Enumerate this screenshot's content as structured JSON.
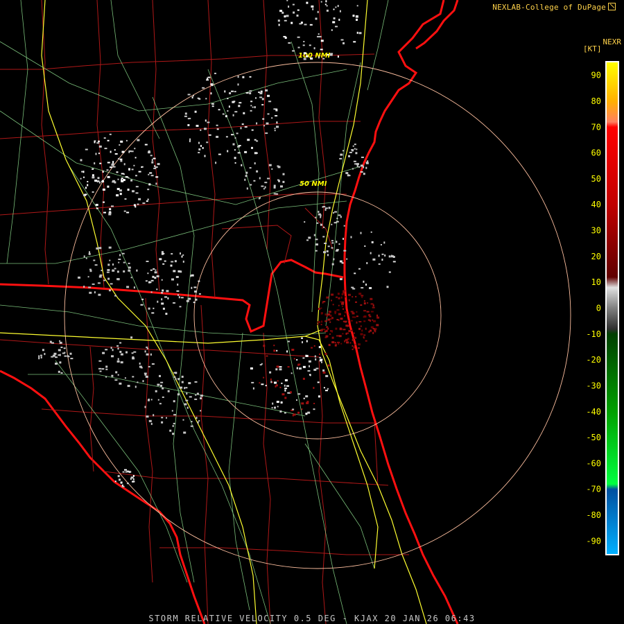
{
  "header": {
    "credit": "NEXLAB-College of DuPage",
    "product": "NEXR",
    "units": "[KT]"
  },
  "footer": {
    "caption": "STORM RELATIVE VELOCITY 0.5 DEG - KJAX 20 JAN 26 06:43"
  },
  "range_rings": [
    {
      "label": "50 NMI",
      "radius_nmi": 50
    },
    {
      "label": "100 NMI",
      "radius_nmi": 100
    }
  ],
  "colorbar": {
    "ticks": [
      "90",
      "80",
      "70",
      "60",
      "50",
      "40",
      "30",
      "20",
      "10",
      "0",
      "-10",
      "-20",
      "-30",
      "-40",
      "-50",
      "-60",
      "-70",
      "-80",
      "-90"
    ],
    "stops": [
      {
        "value": 95,
        "color": "#ffff00"
      },
      {
        "value": 80,
        "color": "#ffb000"
      },
      {
        "value": 72,
        "color": "#ff8060"
      },
      {
        "value": 70,
        "color": "#ff0000"
      },
      {
        "value": 40,
        "color": "#c00000"
      },
      {
        "value": 12,
        "color": "#600000"
      },
      {
        "value": 8,
        "color": "#e0e0e0"
      },
      {
        "value": 0,
        "color": "#808080"
      },
      {
        "value": -8,
        "color": "#303030"
      },
      {
        "value": -10,
        "color": "#004000"
      },
      {
        "value": -40,
        "color": "#00a000"
      },
      {
        "value": -68,
        "color": "#00ff40"
      },
      {
        "value": -70,
        "color": "#0050a0"
      },
      {
        "value": -95,
        "color": "#00b0ff"
      }
    ]
  },
  "colors": {
    "state_border": "#ff1010",
    "county_border": "#b01818",
    "highway": "#ffff30",
    "road": "#90e090",
    "ring": "#ffc0a0",
    "label": "#ffff00"
  }
}
